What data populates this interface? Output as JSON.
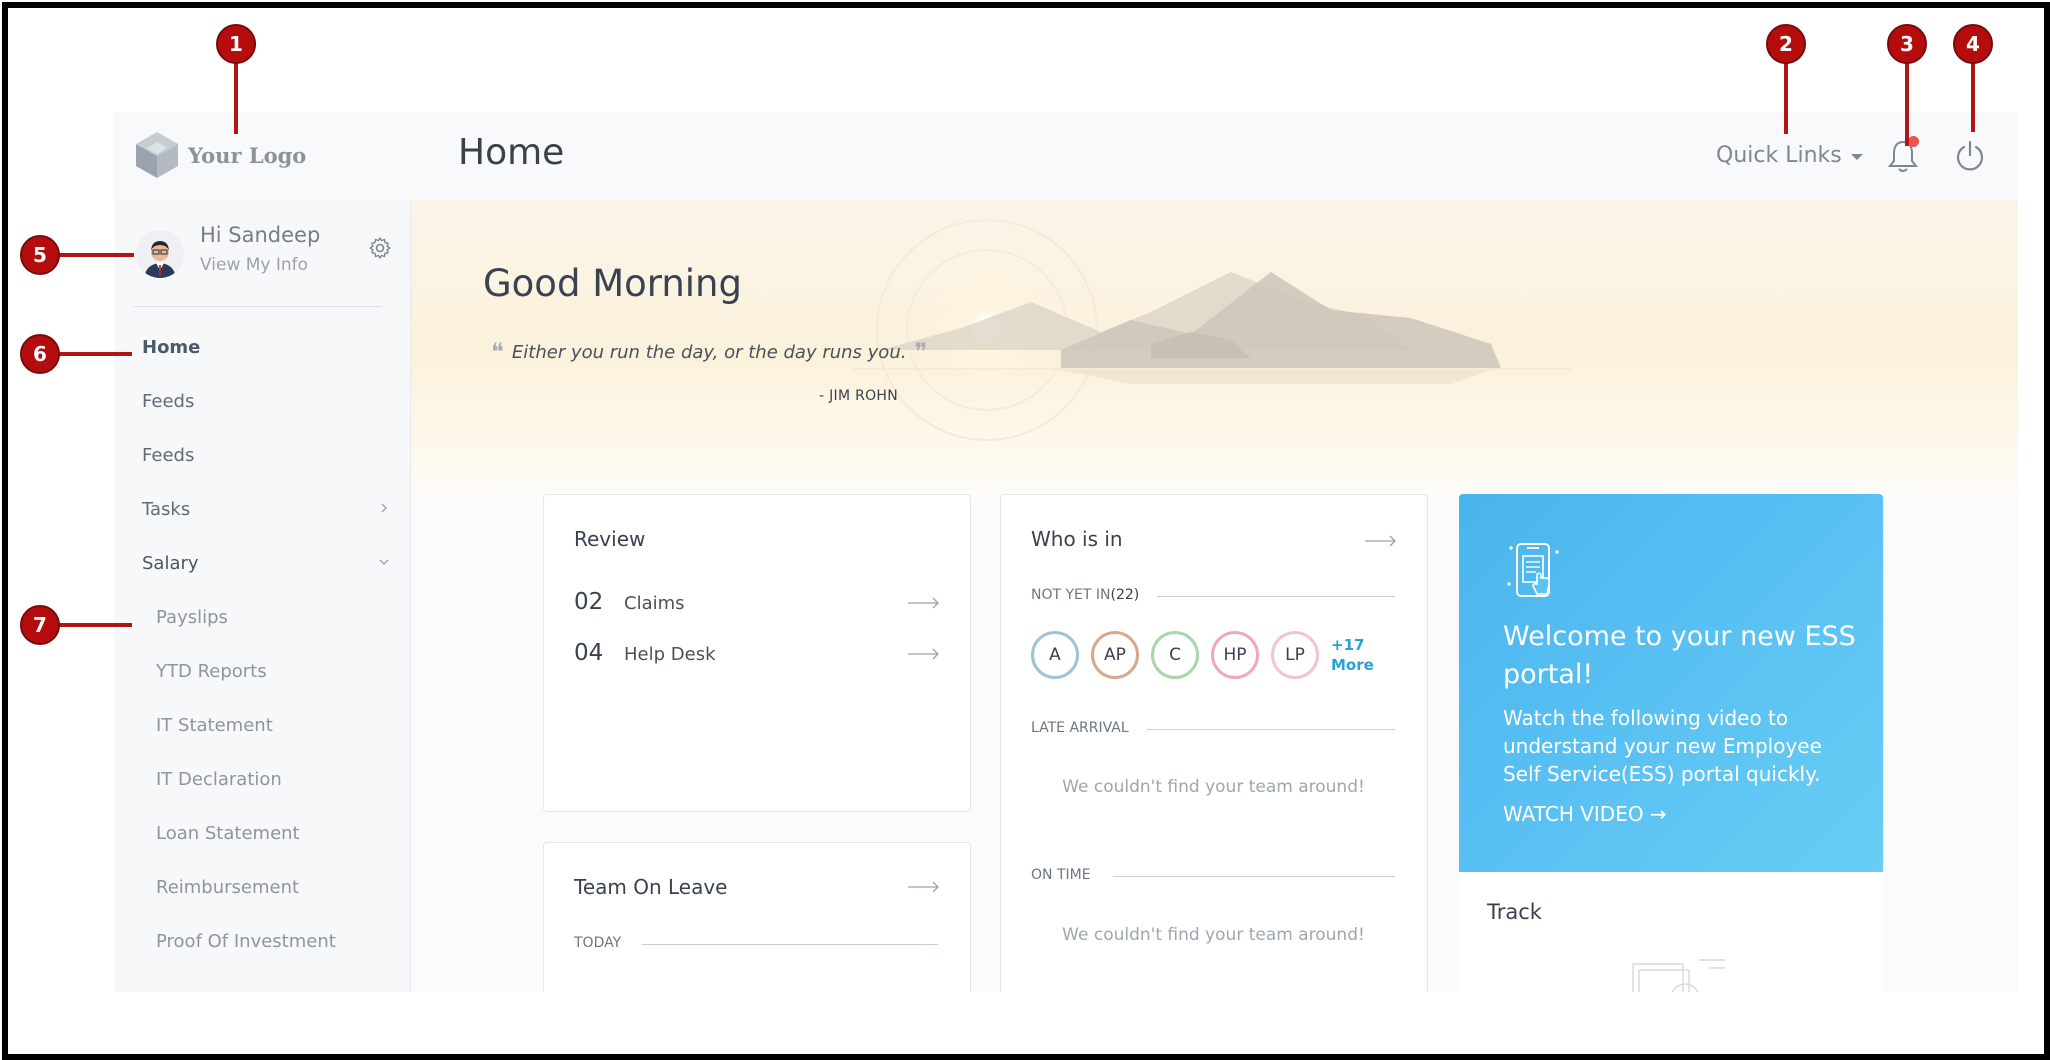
{
  "header": {
    "logo_text": "Your Logo",
    "page_title": "Home",
    "quick_links_label": "Quick Links"
  },
  "sidebar": {
    "greeting": "Hi Sandeep",
    "view_info": "View My Info",
    "items": [
      {
        "label": "Home"
      },
      {
        "label": "Feeds"
      },
      {
        "label": "Feeds"
      },
      {
        "label": "Tasks"
      },
      {
        "label": "Salary"
      },
      {
        "label": "Payslips"
      },
      {
        "label": "YTD Reports"
      },
      {
        "label": "IT Statement"
      },
      {
        "label": "IT Declaration"
      },
      {
        "label": "Loan Statement"
      },
      {
        "label": "Reimbursement"
      },
      {
        "label": "Proof Of Investment"
      }
    ]
  },
  "hero": {
    "greeting": "Good Morning",
    "quote": "Either you run the day, or the day runs you.",
    "author": "- JIM ROHN"
  },
  "review": {
    "title": "Review",
    "rows": [
      {
        "count": "02",
        "label": "Claims"
      },
      {
        "count": "04",
        "label": "Help Desk"
      }
    ]
  },
  "team_leave": {
    "title": "Team On Leave",
    "today_label": "TODAY"
  },
  "who_is_in": {
    "title": "Who is in",
    "not_yet_in_label": "NOT YET IN",
    "not_yet_in_count": "(22)",
    "people": [
      {
        "initials": "A",
        "color": "#9cc3d8"
      },
      {
        "initials": "AP",
        "color": "#d8a88c"
      },
      {
        "initials": "C",
        "color": "#a8d6a8"
      },
      {
        "initials": "HP",
        "color": "#f0a8b8"
      },
      {
        "initials": "LP",
        "color": "#f4c4c8"
      }
    ],
    "more_count": "+17",
    "more_label": "More",
    "late_arrival_label": "LATE ARRIVAL",
    "late_empty": "We couldn't find your team around!",
    "on_time_label": "ON TIME",
    "on_time_empty": "We couldn't find your team around!"
  },
  "welcome": {
    "title": "Welcome to your new ESS portal!",
    "text": "Watch the following video to understand your new Employee Self Service(ESS) portal quickly.",
    "watch_label": "WATCH VIDEO →",
    "track_title": "Track"
  },
  "markers": [
    "1",
    "2",
    "3",
    "4",
    "5",
    "6",
    "7"
  ],
  "colors": {
    "marker": "#b50d0d",
    "accent_blue": "#4ab4ee",
    "notification": "#ef5350"
  }
}
